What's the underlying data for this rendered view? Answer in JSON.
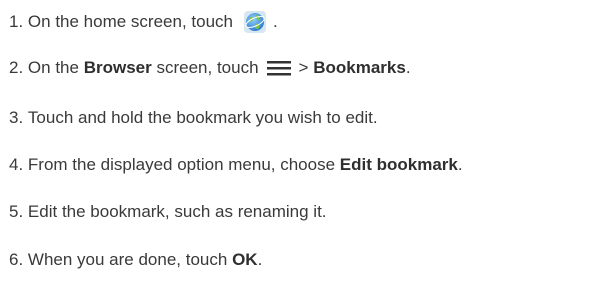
{
  "steps": [
    {
      "num": "1.",
      "before": "On the home screen, touch",
      "icon": "browser-globe-icon",
      "after": "."
    },
    {
      "num": "2.",
      "before": "On the",
      "bold1": "Browser",
      "mid": "screen, touch",
      "icon": "menu-icon",
      "gt": ">",
      "bold2": "Bookmarks",
      "after": "."
    },
    {
      "num": "3.",
      "text": "Touch and hold the bookmark you wish to edit."
    },
    {
      "num": "4.",
      "before": "From the displayed option menu, choose",
      "bold1": "Edit bookmark",
      "after": "."
    },
    {
      "num": "5.",
      "text": "Edit the bookmark, such as renaming it."
    },
    {
      "num": "6.",
      "before": "When you are done, touch",
      "bold1": "OK",
      "after": "."
    }
  ],
  "colors": {
    "text": "#3a3a3a",
    "globe_blue": "#3b8fd6",
    "globe_green": "#7cc242",
    "menu": "#333333"
  }
}
